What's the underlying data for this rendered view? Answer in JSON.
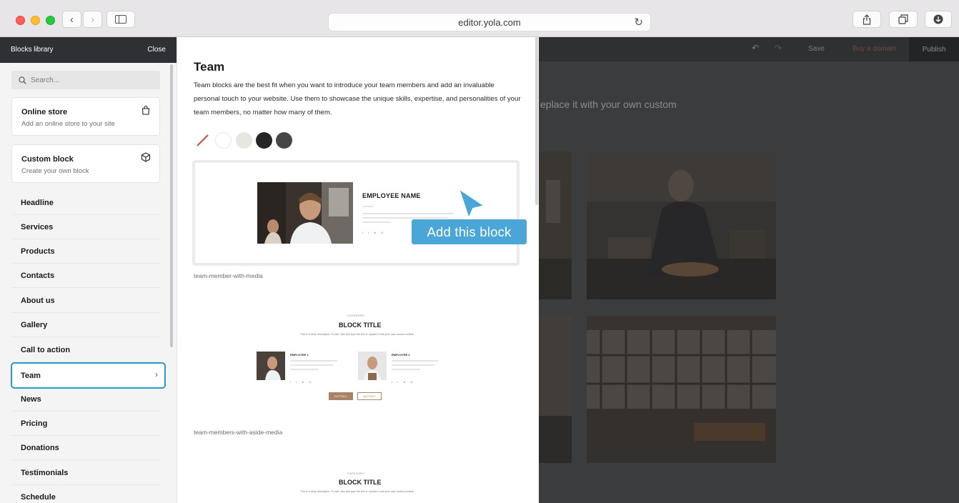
{
  "browser": {
    "url": "editor.yola.com",
    "back_icon": "‹",
    "forward_icon": "›"
  },
  "toolbar": {
    "save": "Save",
    "buy_domain": "Buy a domain",
    "publish": "Publish"
  },
  "background": {
    "text": "eplace it with your own custom"
  },
  "sidebar": {
    "title": "Blocks library",
    "close": "Close",
    "search_placeholder": "Search...",
    "cards": [
      {
        "title": "Online store",
        "subtitle": "Add an online store to your site",
        "icon": "shopping-bag-icon"
      },
      {
        "title": "Custom block",
        "subtitle": "Create your own block",
        "icon": "cube-icon"
      }
    ],
    "items": [
      {
        "label": "Headline"
      },
      {
        "label": "Services"
      },
      {
        "label": "Products"
      },
      {
        "label": "Contacts"
      },
      {
        "label": "About us"
      },
      {
        "label": "Gallery"
      },
      {
        "label": "Call to action"
      },
      {
        "label": "Team",
        "active": true
      },
      {
        "label": "News"
      },
      {
        "label": "Pricing"
      },
      {
        "label": "Donations"
      },
      {
        "label": "Testimonials"
      },
      {
        "label": "Schedule"
      }
    ],
    "active_chevron": "›"
  },
  "panel": {
    "title": "Team",
    "description": "Team blocks are the best fit when you want to introduce your team members and add an invaluable personal touch to your website. Use them to showcase the unique skills, expertise, and personalities of your team members, no matter how many of them.",
    "swatches": [
      "none",
      "#ffffff",
      "#e8e6e1",
      "#262626",
      "#464646"
    ],
    "preview1": {
      "employee_name": "EMPLOYEE NAME",
      "caption": "team-member-with-media"
    },
    "preview2": {
      "category": "CATEGORY",
      "title": "BLOCK TITLE",
      "description": "This is a block description. To edit, click and type the text or replace it with your own custom content.",
      "employee1": "EMPLOYEE 1",
      "employee2": "EMPLOYEE 2",
      "button1": "BUTTON 1",
      "button2": "BUTTON 2",
      "caption": "team-members-with-aside-media"
    },
    "preview3": {
      "category": "CATEGORY",
      "title": "BLOCK TITLE",
      "description": "This is a block description. To edit, click and type the text or replace it with your own custom content."
    }
  },
  "tooltip": {
    "label": "Add this block",
    "color": "#4aa6d6"
  },
  "colors": {
    "accent": "#2a9bc3",
    "sidebar_header": "#2f3034",
    "button_brown": "#a88365"
  }
}
